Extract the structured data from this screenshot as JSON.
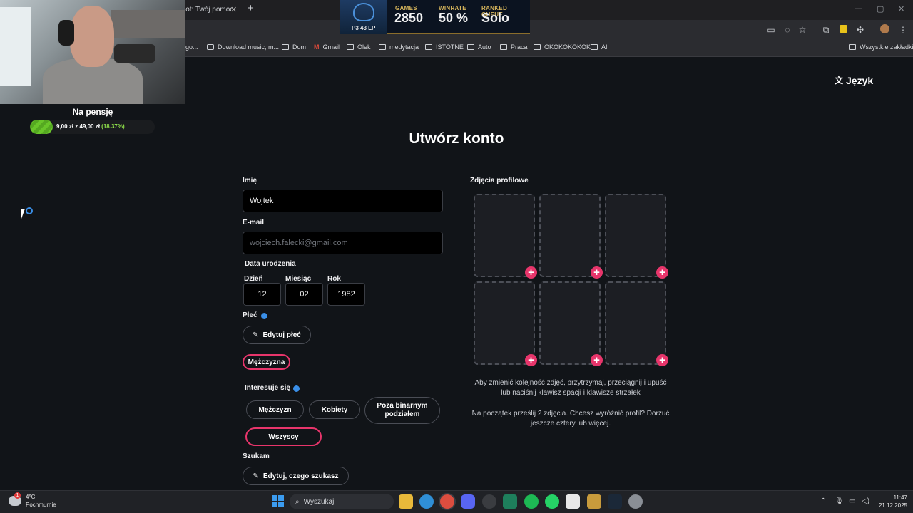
{
  "browser": {
    "tab_title": "lot: Twój pomoc",
    "tab_close": "✕",
    "new_tab": "+",
    "window_controls": [
      "—",
      "▢",
      "✕"
    ],
    "bookmarks": [
      "go...",
      "Download music, m...",
      "Dom",
      "Gmail",
      "Olek",
      "medytacja",
      "ISTOTNE",
      "Auto",
      "Praca",
      "OKOKOKOKOK",
      "AI",
      "Wszystkie zakładki"
    ]
  },
  "overlay": {
    "rank_lp": "P3 43 LP",
    "games_label": "GAMES",
    "games_value": "2850",
    "winrate_label": "WINRATE",
    "winrate_value": "50 %",
    "queue_label": "RANKED QUEUE",
    "queue_value": "Solo"
  },
  "goal": {
    "title": "Na pensję",
    "amount_text": "9,00 zł z 49,00 zł",
    "percent_text": "(18.37%)",
    "progress": 0.1837
  },
  "page": {
    "language_icon": "translate-icon",
    "language_label": "Język",
    "title": "Utwórz konto",
    "name_label": "Imię",
    "name_value": "Wojtek",
    "email_label": "E-mail",
    "email_placeholder": "wojciech.falecki@gmail.com",
    "birth_label": "Data urodzenia",
    "day_label": "Dzień",
    "day_value": "12",
    "month_label": "Miesiąc",
    "month_value": "02",
    "year_label": "Rok",
    "year_value": "1982",
    "gender_label": "Płeć",
    "edit_gender_label": "Edytuj płeć",
    "gender_value": "Mężczyzna",
    "interested_label": "Interesuje się",
    "interest_options": [
      "Mężczyzn",
      "Kobiety",
      "Poza binarnym podziałem",
      "Wszyscy"
    ],
    "interest_selected": "Wszyscy",
    "seeking_label": "Szukam",
    "edit_seeking_label": "Edytuj, czego szukasz",
    "photos_label": "Zdjęcia profilowe",
    "add_photo": "+",
    "photos_hint": "Aby zmienić kolejność zdjęć, przytrzymaj, przeciągnij i upuść lub naciśnij klawisz spacji i klawisze strzałek",
    "photos_hint2": "Na początek prześlij 2 zdjęcia. Chcesz wyróżnić profil? Dorzuć jeszcze cztery lub więcej.",
    "accent_color": "#e8356b"
  },
  "taskbar": {
    "weather_temp": "4°C",
    "weather_desc": "Pochmurnie",
    "weather_badge": "1",
    "search_placeholder": "Wyszukaj",
    "time": "11:47",
    "date": "21.12.2025"
  }
}
